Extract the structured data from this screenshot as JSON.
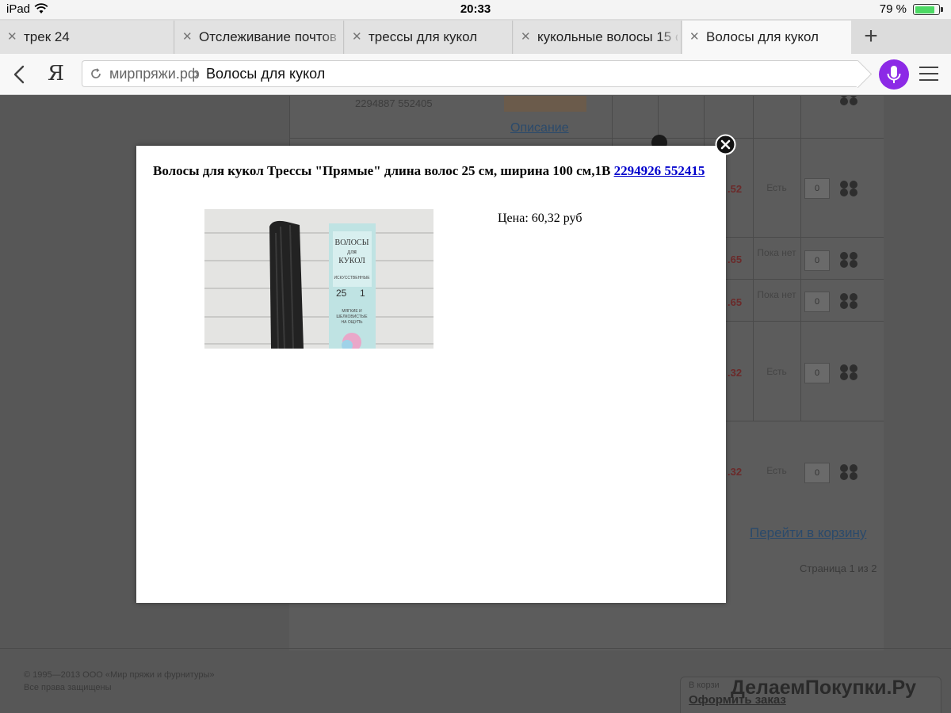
{
  "status_bar": {
    "device": "iPad",
    "time": "20:33",
    "battery_percent_label": "79 %",
    "battery_level": 0.79
  },
  "tabs": [
    {
      "title": "трек 24"
    },
    {
      "title": "Отслеживание почтов"
    },
    {
      "title": "трессы для кукол"
    },
    {
      "title": "кукольные волосы 15 с"
    },
    {
      "title": "Волосы для кукол"
    }
  ],
  "address": {
    "domain": "мирпряжи.рф",
    "separator": "›",
    "page": "Волосы для кукол",
    "logo": "Я"
  },
  "background_page": {
    "partial_article": "2294887 552405",
    "description_link": "Описание",
    "prices": [
      ".52",
      ".65",
      ".65",
      ".32",
      ".32"
    ],
    "statuses": [
      "Есть",
      "Пока нет",
      "Пока нет",
      "Есть",
      "Есть"
    ],
    "quantities": [
      "0",
      "0",
      "0",
      "0",
      "0"
    ],
    "go_to_cart": "Перейти в корзину",
    "pagination": "Страница 1 из 2",
    "copyright": "© 1995—2013 ООО «Мир пряжи и фурнитуры»",
    "rights": "Все права защищены",
    "cart_label": "В корзи",
    "checkout": "Оформить заказ",
    "watermark": "ДелаемПокупки.Ру"
  },
  "modal": {
    "title_text": "Волосы для кукол Трессы \"Прямые\" длина волос 25 см, ширина 100 см,1В ",
    "article_link": "2294926 552415",
    "price_text": "Цена: 60,32 руб",
    "package_text": {
      "brand_top": "ВОЛОСЫ",
      "brand_mid": "для",
      "brand_bottom": "КУКОЛ",
      "kind": "ИСКУССТВЕННЫЕ",
      "length": "25",
      "width": "1",
      "note1": "МЯГКИЕ И",
      "note2": "ШЕЛКОВИСТЫЕ",
      "note3": "НА ОЩУПЬ"
    }
  },
  "colors": {
    "accent_mic": "#8c2ae6",
    "battery": "#4cd964",
    "link": "#0000cc"
  }
}
